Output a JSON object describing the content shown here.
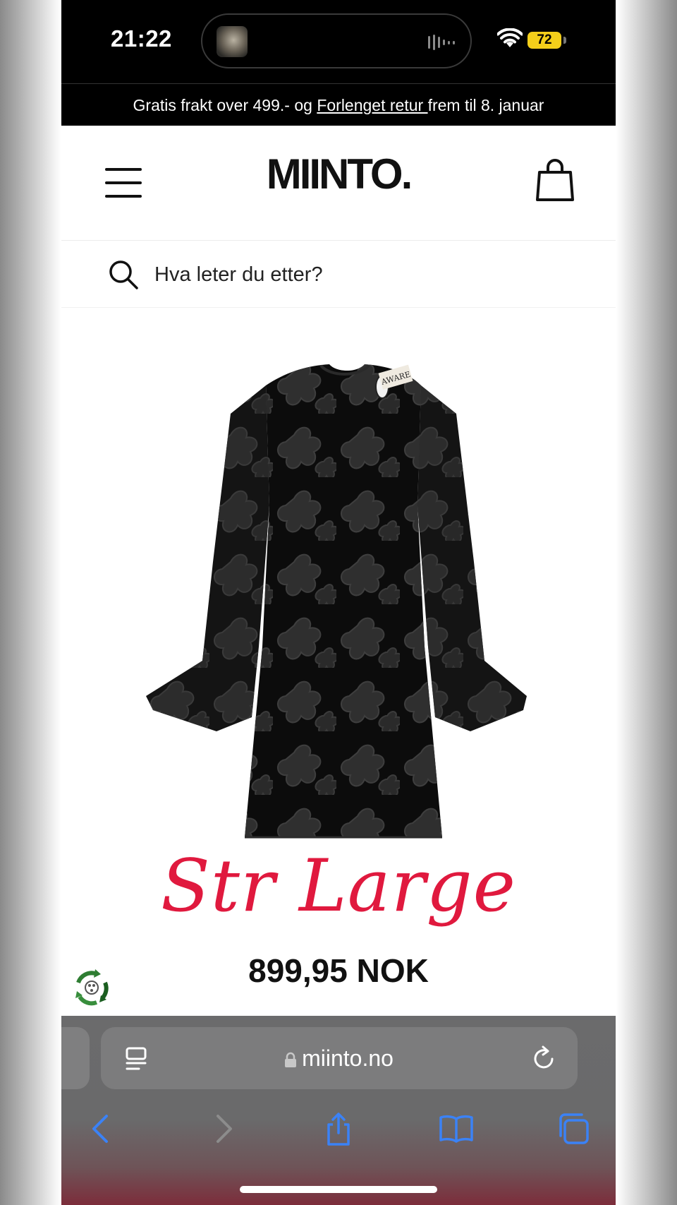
{
  "status_bar": {
    "time": "21:22",
    "battery": "72"
  },
  "promo": {
    "text_before": "Gratis frakt over 499.- og ",
    "link": "Forlenget retur ",
    "text_after": "frem til 8. januar"
  },
  "header": {
    "logo": "MIINTO."
  },
  "search": {
    "placeholder": "Hva leter du etter?"
  },
  "product": {
    "brand_tag": "AWARE",
    "size_label": "Str Large",
    "price": "899,95 NOK"
  },
  "browser": {
    "url": "miinto.no"
  },
  "colors": {
    "accent_red": "#e0193e",
    "safari_blue": "#3b82f6",
    "battery_yellow": "#f4cf1a"
  }
}
